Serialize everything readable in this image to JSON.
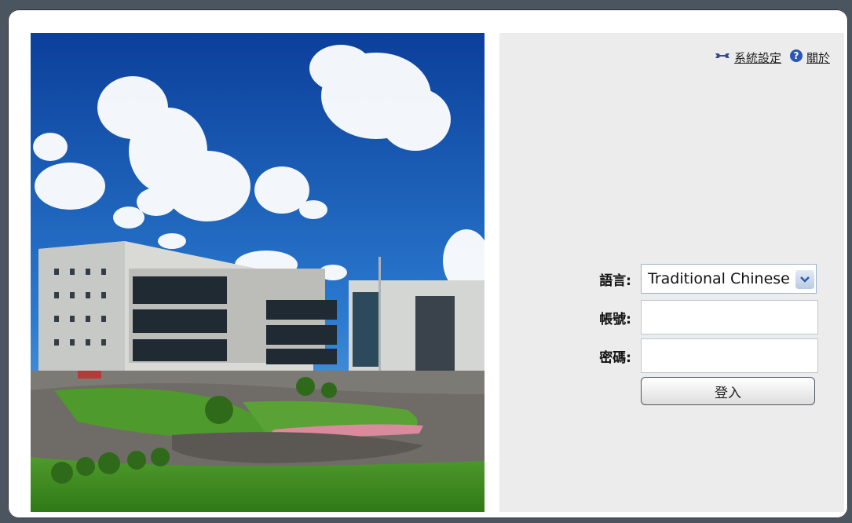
{
  "header_links": {
    "settings_label": "系統設定",
    "about_label": "關於"
  },
  "form": {
    "language_label": "語言:",
    "language_value": "Traditional Chinese",
    "account_label": "帳號:",
    "password_label": "密碼:",
    "login_button": "登入"
  },
  "icons": {
    "settings": "wrench-icon",
    "about": "help-icon",
    "select": "chevron-down-icon"
  },
  "colors": {
    "panel_bg": "#ececec",
    "frame_bg": "#ffffff",
    "page_bg": "#4b5560"
  }
}
